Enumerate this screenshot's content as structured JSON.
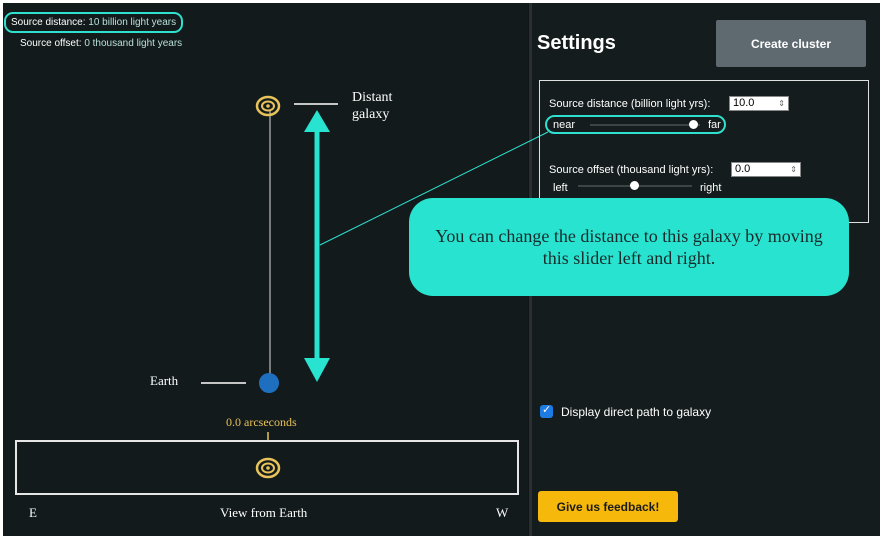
{
  "readouts": {
    "distance_label": "Source distance:",
    "distance_value": "10 billion light years",
    "offset_label": "Source offset:",
    "offset_value": "0 thousand light years"
  },
  "diagram": {
    "distant_label_1": "Distant",
    "distant_label_2": "galaxy",
    "earth_label": "Earth",
    "arcseconds": "0.0 arcseconds",
    "view_label": "View from Earth",
    "east": "E",
    "west": "W"
  },
  "settings": {
    "title": "Settings",
    "create_button": "Create cluster",
    "distance_label": "Source distance (billion light yrs):",
    "distance_value": "10.0",
    "distance_slider": {
      "min_label": "near",
      "max_label": "far",
      "value_fraction": 0.92
    },
    "offset_label": "Source offset (thousand light yrs):",
    "offset_value": "0.0",
    "offset_slider": {
      "min_label": "left",
      "max_label": "right",
      "value_fraction": 0.5
    },
    "display_path_label": "Display direct path to galaxy",
    "display_path_checked": true,
    "feedback_button": "Give us feedback!"
  },
  "callout": {
    "text": "You can change the distance to this galaxy by moving this slider left and right."
  },
  "colors": {
    "accent": "#2fe0cf",
    "galaxy": "#e8c25a",
    "earth": "#1f6fc0",
    "feedback": "#f6b80a",
    "checkbox": "#1e7be4"
  }
}
